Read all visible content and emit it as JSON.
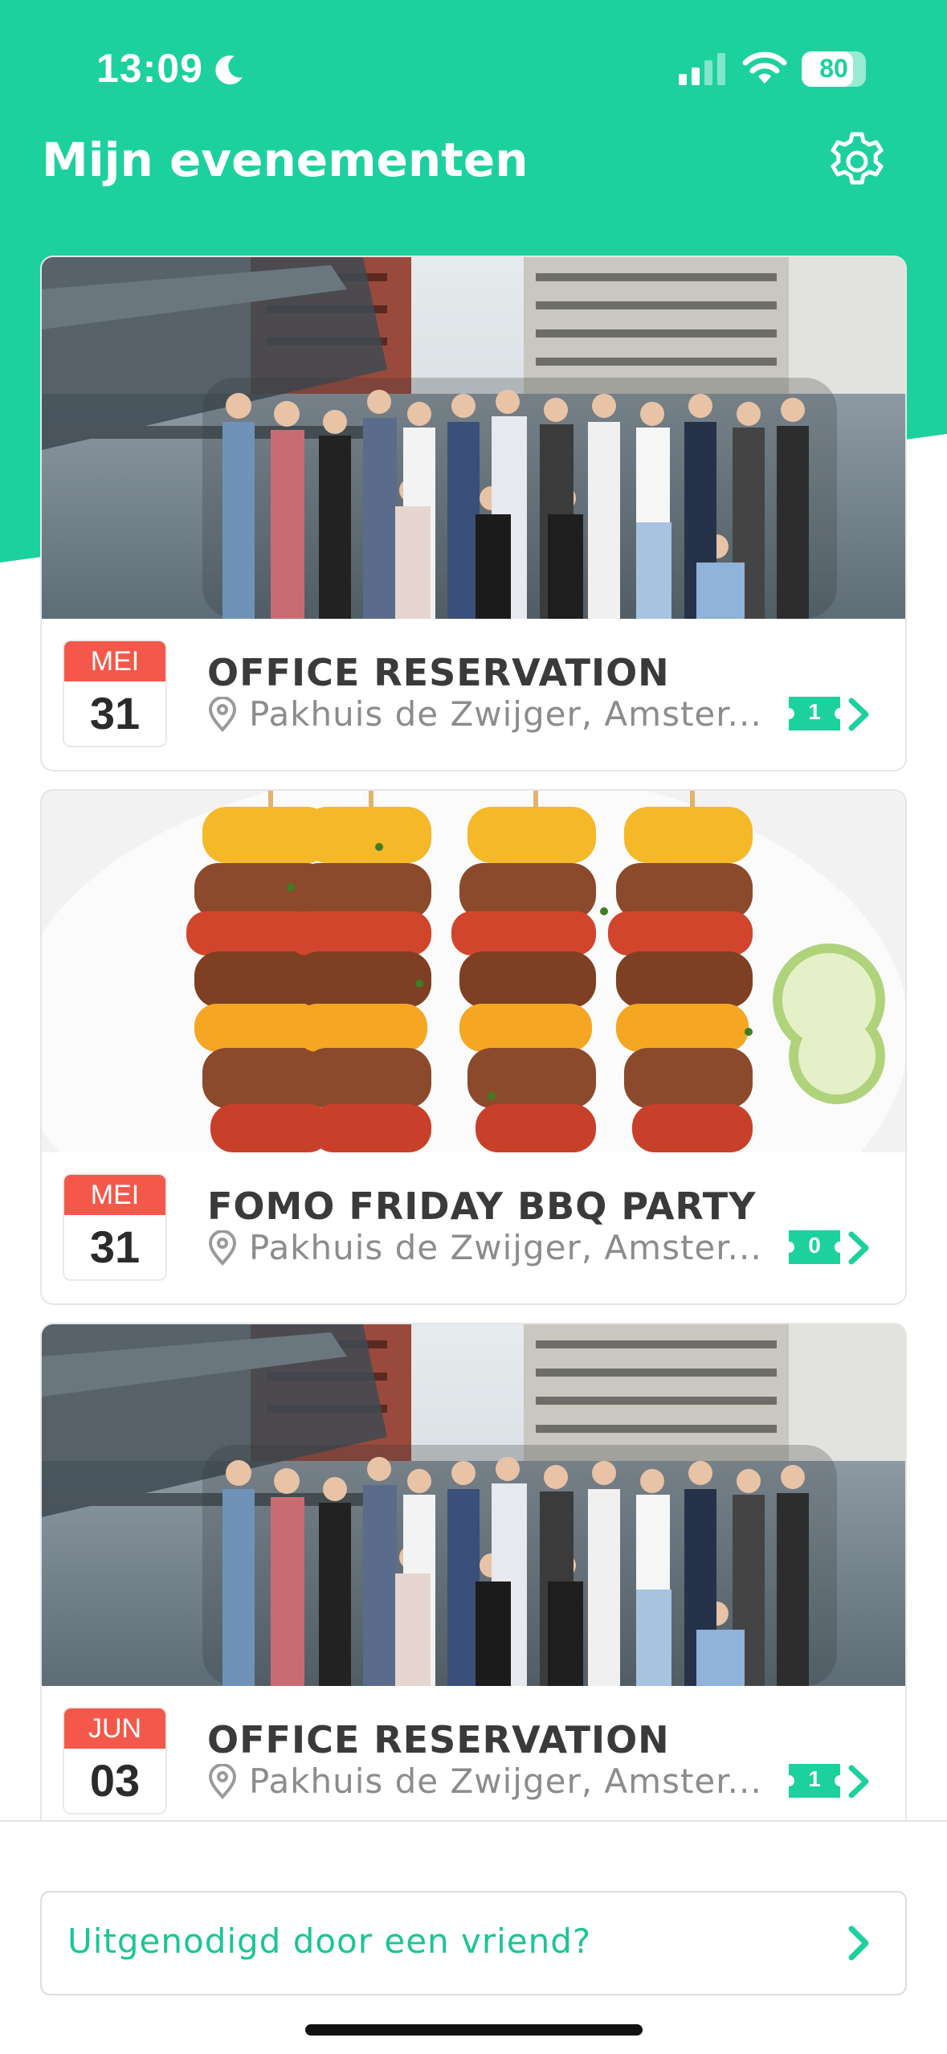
{
  "status_bar": {
    "time": "13:09",
    "battery": "80",
    "battery_level": 0.8
  },
  "header": {
    "title": "Mijn evenementen"
  },
  "events": [
    {
      "month": "MEI",
      "day": "31",
      "title": "OFFICE RESERVATION",
      "location": "Pakhuis de Zwijger, Amster...",
      "tickets": "1",
      "image": "team-photo"
    },
    {
      "month": "MEI",
      "day": "31",
      "title": "FOMO FRIDAY BBQ PARTY",
      "location": "Pakhuis de Zwijger, Amster...",
      "tickets": "0",
      "image": "bbq-skewers"
    },
    {
      "month": "JUN",
      "day": "03",
      "title": "OFFICE RESERVATION",
      "location": "Pakhuis de Zwijger, Amster...",
      "tickets": "1",
      "image": "team-photo"
    }
  ],
  "invite": {
    "label": "Uitgenodigd door een vriend?"
  },
  "colors": {
    "brand_green": "#1cd19e",
    "date_red": "#f4584a"
  }
}
